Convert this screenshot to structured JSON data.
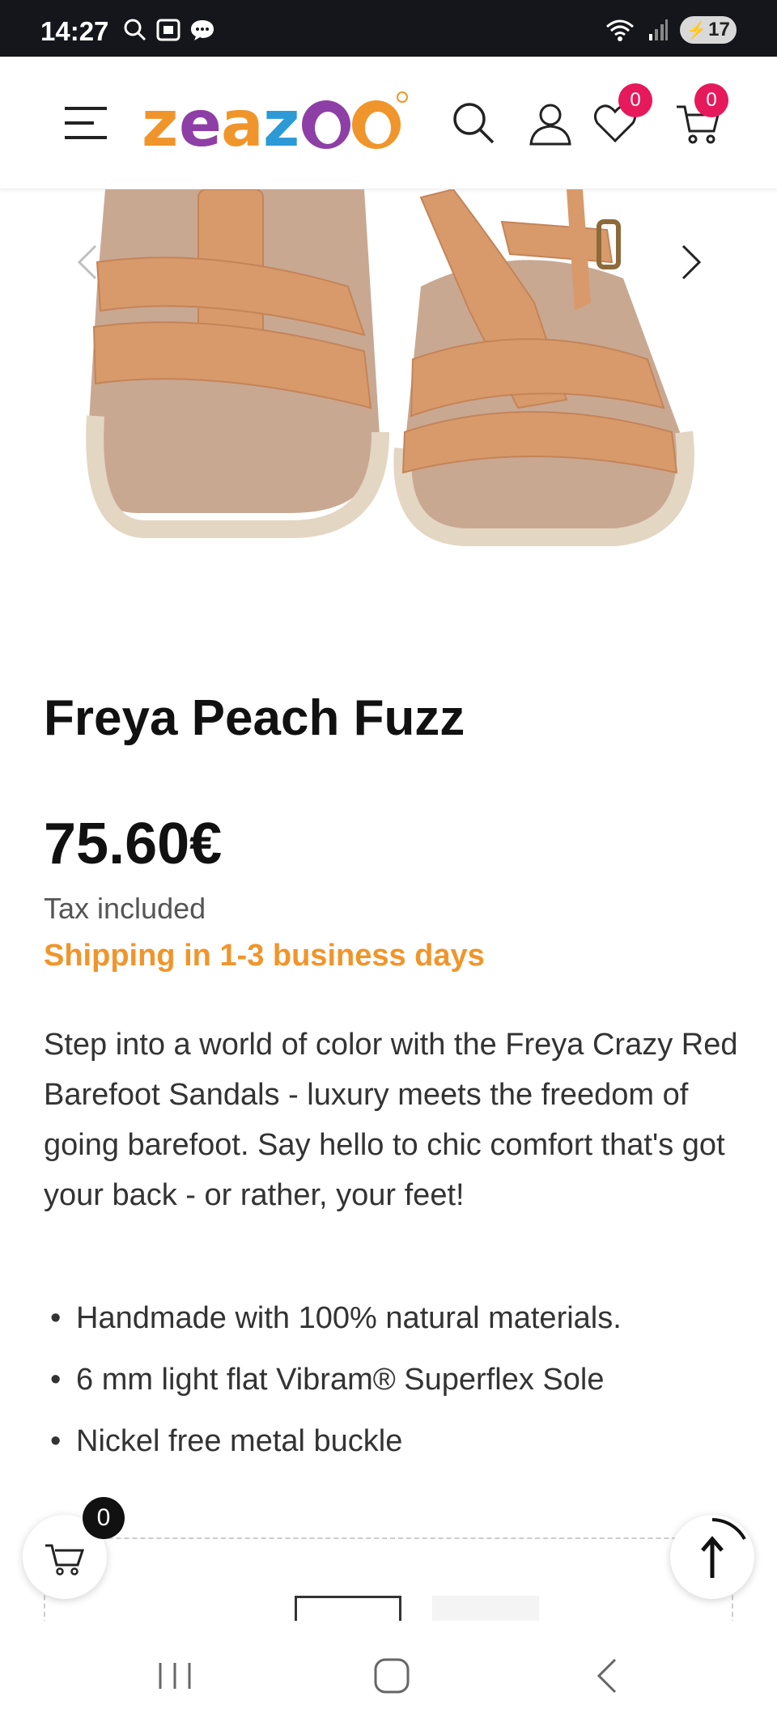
{
  "status_bar": {
    "time": "14:27",
    "battery": "17",
    "icons": [
      "search-icon",
      "screenshot-icon",
      "chat-icon",
      "wifi-icon",
      "signal-icon",
      "battery-icon"
    ]
  },
  "header": {
    "logo_text": "zeazoo",
    "wishlist_count": "0",
    "cart_count": "0",
    "icons": [
      "menu-icon",
      "search-icon",
      "account-icon",
      "heart-icon",
      "cart-icon"
    ],
    "badge_color": "#e6195c"
  },
  "product": {
    "title": "Freya Peach Fuzz",
    "price": "75.60€",
    "tax_note": "Tax included",
    "shipping": "Shipping in 1-3 business days",
    "description": "Step into a world of color with the Freya Crazy Red Barefoot Sandals - luxury meets the freedom of going barefoot. Say hello to chic comfort that's got your back - or rather, your feet!",
    "features": [
      "Handmade with 100% natural materials.",
      "6 mm light flat Vibram® Superflex Sole",
      "Nickel free metal buckle"
    ],
    "shipping_color": "#f0952b"
  },
  "floating": {
    "cart_count": "0"
  },
  "colors": {
    "logo_orange": "#f0952b",
    "logo_purple": "#8e3fa6",
    "logo_blue": "#2b9ad6",
    "sandal_leather": "#d89a6b"
  }
}
